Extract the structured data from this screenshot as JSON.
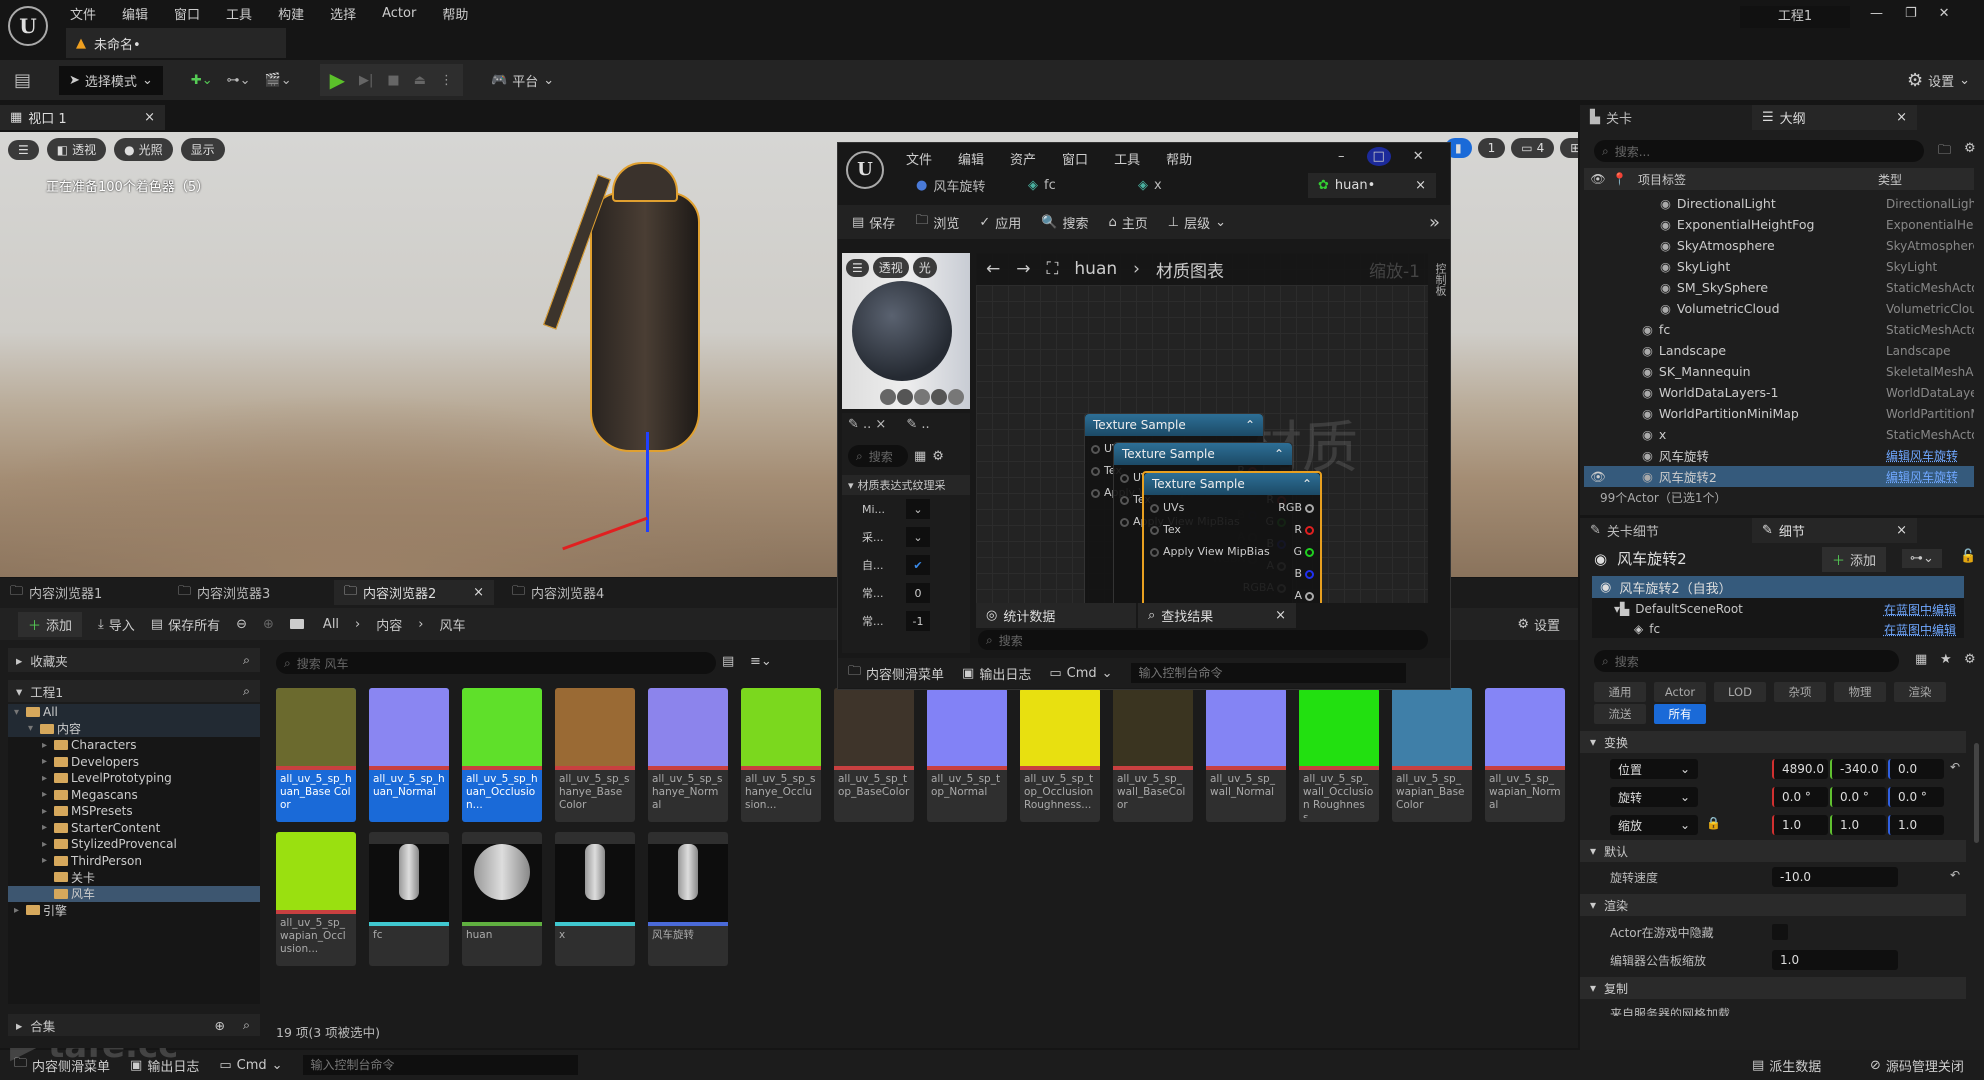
{
  "app": {
    "menu": [
      "文件",
      "编辑",
      "窗口",
      "工具",
      "构建",
      "选择",
      "Actor",
      "帮助"
    ],
    "doc_tab": "未命名•",
    "project": "工程1"
  },
  "toolbar": {
    "mode": "选择模式",
    "platform": "平台",
    "settings": "设置"
  },
  "viewport": {
    "tab": "视口 1",
    "buttons": [
      "透视",
      "光照",
      "显示"
    ],
    "status": "正在准备100个着色器（5）",
    "right_badges": [
      "1",
      "4"
    ]
  },
  "material_editor": {
    "menu": [
      "文件",
      "编辑",
      "资产",
      "窗口",
      "工具",
      "帮助"
    ],
    "tabs": [
      "风车旋转",
      "fc",
      "x",
      "huan•"
    ],
    "toolbar": [
      "保存",
      "浏览",
      "应用",
      "搜索",
      "主页",
      "层级"
    ],
    "preview_buttons": [
      "透视",
      "光"
    ],
    "breadcrumb": {
      "root": "huan",
      "current": "材质图表"
    },
    "zoom": "缩放-1",
    "side_label": "控制板",
    "watermark": "材质",
    "details": {
      "search": "搜索",
      "category": "材质表达式纹理采",
      "props": [
        {
          "label": "Mi...",
          "value": ""
        },
        {
          "label": "采...",
          "value": ""
        },
        {
          "label": "自...",
          "value": "checked"
        },
        {
          "label": "常...",
          "value": "0"
        },
        {
          "label": "常...",
          "value": "-1"
        }
      ]
    },
    "nodes": [
      {
        "title": "Texture Sample"
      },
      {
        "title": "Texture Sample"
      },
      {
        "title": "Texture Sample"
      }
    ],
    "pins": {
      "inputs": [
        "UVs",
        "Tex",
        "Apply View MipBias"
      ],
      "outputs": [
        "RGB",
        "R",
        "G",
        "B",
        "A",
        "RGBA"
      ]
    },
    "bottom_tabs": [
      "统计数据",
      "查找结果"
    ],
    "find_placeholder": "搜索",
    "bottom_bar": {
      "drawer": "内容侧滑菜单",
      "log": "输出日志",
      "cmd": "Cmd",
      "console_placeholder": "输入控制台命令"
    }
  },
  "outliner": {
    "tabs": [
      "关卡",
      "大纲"
    ],
    "search_placeholder": "搜索...",
    "col_label": "项目标签",
    "col_type": "类型",
    "rows": [
      {
        "label": "DirectionalLight",
        "type": "DirectionalLight",
        "indent": 2
      },
      {
        "label": "ExponentialHeightFog",
        "type": "ExponentialHeightFog",
        "indent": 2
      },
      {
        "label": "SkyAtmosphere",
        "type": "SkyAtmosphere",
        "indent": 2
      },
      {
        "label": "SkyLight",
        "type": "SkyLight",
        "indent": 2
      },
      {
        "label": "SM_SkySphere",
        "type": "StaticMeshActor",
        "indent": 2
      },
      {
        "label": "VolumetricCloud",
        "type": "VolumetricCloud",
        "indent": 2
      },
      {
        "label": "fc",
        "type": "StaticMeshActor",
        "indent": 1
      },
      {
        "label": "Landscape",
        "type": "Landscape",
        "indent": 1
      },
      {
        "label": "SK_Mannequin",
        "type": "SkeletalMeshActor",
        "indent": 1
      },
      {
        "label": "WorldDataLayers-1",
        "type": "WorldDataLayers",
        "indent": 1
      },
      {
        "label": "WorldPartitionMiniMap",
        "type": "WorldPartitionMiniMap",
        "indent": 1
      },
      {
        "label": "x",
        "type": "StaticMeshActor",
        "indent": 1
      },
      {
        "label": "风车旋转",
        "type": "编辑风车旋转",
        "indent": 1,
        "link": true
      },
      {
        "label": "风车旋转2",
        "type": "编辑风车旋转",
        "indent": 1,
        "link": true,
        "selected": true
      }
    ],
    "status": "99个Actor（已选1个）"
  },
  "details": {
    "tabs": [
      "关卡细节",
      "细节"
    ],
    "actor": "风车旋转2",
    "add": "添加",
    "components": [
      {
        "label": "风车旋转2（自我）"
      },
      {
        "label": "DefaultSceneRoot",
        "link": "在蓝图中编辑"
      },
      {
        "label": "fc",
        "link": "在蓝图中编辑"
      }
    ],
    "search_placeholder": "搜索",
    "filters": [
      "通用",
      "Actor",
      "LOD",
      "杂项",
      "物理",
      "渲染",
      "流送",
      "所有"
    ],
    "active_filter": "所有",
    "transform": {
      "title": "变换",
      "location": {
        "label": "位置",
        "x": "4890.0",
        "y": "-340.0",
        "z": "0.0"
      },
      "rotation": {
        "label": "旋转",
        "x": "0.0 °",
        "y": "0.0 °",
        "z": "0.0 °"
      },
      "scale": {
        "label": "缩放",
        "x": "1.0",
        "y": "1.0",
        "z": "1.0"
      }
    },
    "default": {
      "title": "默认",
      "rotate_speed_label": "旋转速度",
      "rotate_speed": "-10.0"
    },
    "render": {
      "title": "渲染",
      "hidden_label": "Actor在游戏中隐藏",
      "billboard_label": "编辑器公告板缩放",
      "billboard": "1.0"
    },
    "replication": {
      "title": "复制",
      "row": "来自服务器的网格加载"
    }
  },
  "content_browser": {
    "tabs": [
      "内容浏览器1",
      "内容浏览器3",
      "内容浏览器2",
      "内容浏览器4"
    ],
    "active_tab": "内容浏览器2",
    "toolbar": {
      "add": "添加",
      "import": "导入",
      "save_all": "保存所有"
    },
    "path": [
      "All",
      "内容",
      "风车"
    ],
    "settings": "设置",
    "favorites": "收藏夹",
    "project": "工程1",
    "collections": "合集",
    "search_placeholder": "搜索 风车",
    "tree": [
      {
        "label": "All",
        "depth": 0,
        "open": true
      },
      {
        "label": "内容",
        "depth": 1,
        "open": true
      },
      {
        "label": "Characters",
        "depth": 2
      },
      {
        "label": "Developers",
        "depth": 2
      },
      {
        "label": "LevelPrototyping",
        "depth": 2
      },
      {
        "label": "Megascans",
        "depth": 2
      },
      {
        "label": "MSPresets",
        "depth": 2
      },
      {
        "label": "StarterContent",
        "depth": 2
      },
      {
        "label": "StylizedProvencal",
        "depth": 2
      },
      {
        "label": "ThirdPerson",
        "depth": 2
      },
      {
        "label": "关卡",
        "depth": 2
      },
      {
        "label": "风车",
        "depth": 2,
        "selected": true
      },
      {
        "label": "引擎",
        "depth": 0
      }
    ],
    "assets": [
      {
        "label": "all_uv_5_sp_huan_Base Color",
        "thumb": "#6b6a2e",
        "bar": "#c94040",
        "selected": true
      },
      {
        "label": "all_uv_5_sp_huan_Normal",
        "thumb": "#8a86f2",
        "bar": "#c94040",
        "selected": true
      },
      {
        "label": "all_uv_5_sp_huan_Occlusion...",
        "thumb": "#5fe02a",
        "bar": "#c94040",
        "selected": true
      },
      {
        "label": "all_uv_5_sp_shanye_Base Color",
        "thumb": "#9a6a34",
        "bar": "#c94040"
      },
      {
        "label": "all_uv_5_sp_shanye_Normal",
        "thumb": "#8c84ec",
        "bar": "#c94040"
      },
      {
        "label": "all_uv_5_sp_shanye_Occlusion...",
        "thumb": "#7bd81e",
        "bar": "#c94040"
      },
      {
        "label": "all_uv_5_sp_top_BaseColor",
        "thumb": "#3e342a",
        "bar": "#c94040"
      },
      {
        "label": "all_uv_5_sp_top_Normal",
        "thumb": "#8282f6",
        "bar": "#c94040"
      },
      {
        "label": "all_uv_5_sp_top_Occlusion Roughness...",
        "thumb": "#e8e010",
        "bar": "#c94040"
      },
      {
        "label": "all_uv_5_sp_wall_BaseColor",
        "thumb": "#3a3420",
        "bar": "#c94040"
      },
      {
        "label": "all_uv_5_sp_wall_Normal",
        "thumb": "#8484f4",
        "bar": "#c94040"
      },
      {
        "label": "all_uv_5_sp_wall_Occlusion Roughness...",
        "thumb": "#22e010",
        "bar": "#c94040"
      },
      {
        "label": "all_uv_5_sp_wapian_Base Color",
        "thumb": "#3f7fa8",
        "bar": "#c94040"
      },
      {
        "label": "all_uv_5_sp_wapian_Normal",
        "thumb": "#8585f6",
        "bar": "#c94040"
      },
      {
        "label": "all_uv_5_sp_wapian_Occlusion...",
        "thumb": "#9ae010",
        "bar": "#c94040"
      },
      {
        "label": "fc",
        "thumb": "#0d0d0d",
        "bar": "#40c8d0"
      },
      {
        "label": "huan",
        "thumb": "#0d0d0d",
        "bar": "#60b040"
      },
      {
        "label": "x",
        "thumb": "#0d0d0d",
        "bar": "#40c8d0"
      },
      {
        "label": "风车旋转",
        "thumb": "#0d0d0d",
        "bar": "#4a6ad8"
      }
    ],
    "count": "19 项(3 项被选中)"
  },
  "statusbar": {
    "drawer": "内容侧滑菜单",
    "log": "输出日志",
    "cmd": "Cmd",
    "console_placeholder": "输入控制台命令",
    "derived": "派生数据",
    "source_control": "源码管理关闭"
  },
  "watermark": "tafe.cc"
}
